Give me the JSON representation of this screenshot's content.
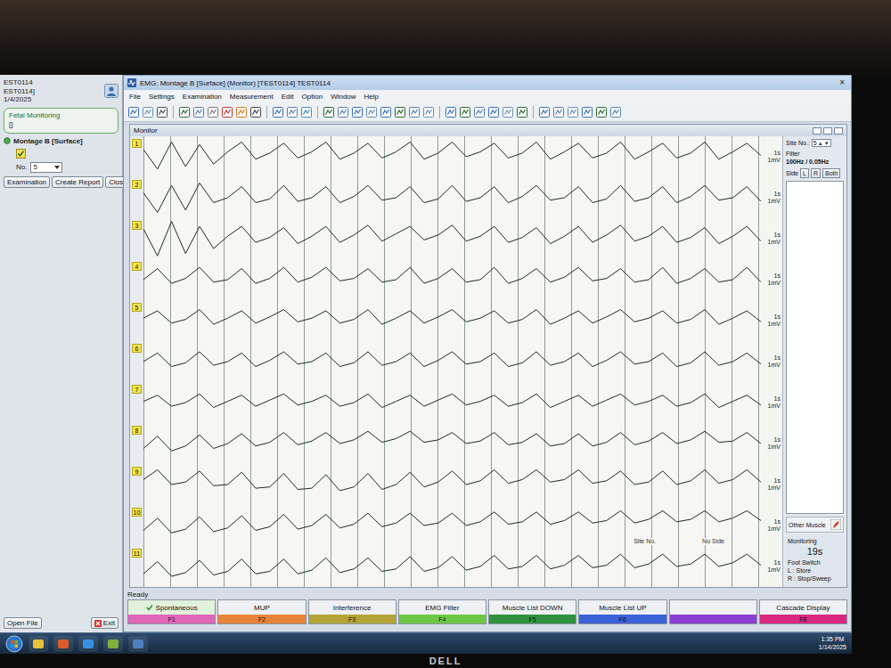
{
  "left_panel": {
    "patient_lines": [
      "EST0114",
      "EST0114]",
      "1/4/2025"
    ],
    "exam_group": {
      "title": "Fetal Monitoring",
      "value": "[]"
    },
    "montage": {
      "label": "Montage B [Surface]",
      "checked": true
    },
    "number": {
      "label": "No.",
      "value": "5"
    },
    "buttons": [
      "Examination",
      "Create Report",
      "Close"
    ],
    "bottom_buttons": [
      "Open File",
      "Exit"
    ]
  },
  "window": {
    "title": "EMG: Montage B [Surface]  (Monitor) [TEST0114]  TEST0114",
    "close": "×"
  },
  "menu": [
    "File",
    "Settings",
    "Examination",
    "Measurement",
    "Edit",
    "Option",
    "Window",
    "Help"
  ],
  "monitor": {
    "title": "Monitor",
    "channels": [
      {
        "number": "1",
        "time_scale": "1s",
        "amp_scale": "1mV",
        "labels": [],
        "values": [
          0.3,
          -0.5,
          0.6,
          -0.4,
          0.5,
          -0.3,
          0.2,
          0.6,
          -0.1,
          0.15,
          0.55,
          -0.05,
          0.2,
          0.6,
          -0.1,
          0.15,
          0.55,
          -0.05,
          0.2,
          0.6,
          -0.1,
          0.15,
          0.6,
          0.0,
          0.2,
          0.55,
          -0.05,
          0.15,
          0.6,
          -0.1,
          0.2,
          0.55,
          -0.05,
          0.15,
          0.6,
          -0.1,
          0.2,
          0.55,
          -0.05,
          0.15,
          0.6,
          -0.1,
          0.2,
          0.55,
          0.05
        ]
      },
      {
        "number": "2",
        "time_scale": "1s",
        "amp_scale": "1mV",
        "labels": [],
        "values": [
          0.2,
          -0.6,
          0.5,
          -0.5,
          0.6,
          -0.2,
          0.0,
          0.45,
          -0.2,
          -0.05,
          0.5,
          -0.15,
          0.0,
          0.45,
          -0.2,
          0.05,
          0.5,
          -0.1,
          0.0,
          0.45,
          -0.2,
          -0.05,
          0.5,
          -0.15,
          0.0,
          0.45,
          -0.2,
          0.05,
          0.5,
          -0.1,
          0.0,
          0.45,
          -0.2,
          -0.05,
          0.5,
          -0.15,
          0.0,
          0.45,
          -0.2,
          0.05,
          0.5,
          -0.1,
          0.0,
          0.45,
          -0.15
        ]
      },
      {
        "number": "3",
        "time_scale": "1s",
        "amp_scale": "1mV",
        "labels": [],
        "values": [
          0.4,
          -0.7,
          0.7,
          -0.6,
          0.5,
          -0.4,
          0.1,
          0.5,
          -0.15,
          0.05,
          0.45,
          -0.2,
          0.1,
          0.5,
          -0.15,
          0.15,
          0.55,
          -0.1,
          0.2,
          0.5,
          -0.05,
          0.15,
          0.55,
          -0.1,
          0.1,
          0.5,
          -0.15,
          0.05,
          0.45,
          -0.2,
          0.1,
          0.5,
          -0.15,
          0.15,
          0.55,
          -0.1,
          0.1,
          0.5,
          -0.15,
          0.05,
          0.45,
          -0.2,
          0.1,
          0.5,
          -0.1
        ]
      },
      {
        "number": "4",
        "time_scale": "1s",
        "amp_scale": "1mV",
        "labels": [],
        "values": [
          0.0,
          0.45,
          -0.15,
          0.05,
          0.5,
          -0.1,
          0.0,
          0.45,
          -0.15,
          0.05,
          0.5,
          -0.1,
          0.1,
          0.5,
          -0.05,
          0.05,
          0.45,
          -0.1,
          0.0,
          0.5,
          -0.15,
          0.05,
          0.45,
          -0.1,
          0.0,
          0.5,
          -0.15,
          0.05,
          0.45,
          -0.1,
          0.1,
          0.5,
          -0.05,
          0.05,
          0.45,
          -0.1,
          0.0,
          0.5,
          -0.15,
          0.05,
          0.45,
          -0.1,
          0.0,
          0.5,
          -0.1
        ]
      },
      {
        "number": "5",
        "time_scale": "1s",
        "amp_scale": "1mV",
        "labels": [],
        "values": [
          0.1,
          0.4,
          -0.1,
          0.05,
          0.45,
          -0.15,
          0.1,
          0.4,
          -0.1,
          0.15,
          0.45,
          -0.05,
          0.1,
          0.4,
          -0.1,
          0.05,
          0.45,
          -0.15,
          0.1,
          0.4,
          -0.1,
          0.15,
          0.45,
          -0.05,
          0.1,
          0.4,
          -0.1,
          0.05,
          0.45,
          -0.15,
          0.1,
          0.4,
          -0.1,
          0.15,
          0.45,
          -0.05,
          0.1,
          0.4,
          -0.1,
          0.05,
          0.45,
          -0.15,
          0.1,
          0.4,
          -0.05
        ]
      },
      {
        "number": "6",
        "time_scale": "1s",
        "amp_scale": "1mV",
        "labels": [],
        "values": [
          0.0,
          0.35,
          -0.2,
          -0.05,
          0.4,
          -0.15,
          0.0,
          0.35,
          -0.2,
          0.05,
          0.4,
          -0.1,
          0.0,
          0.35,
          -0.2,
          -0.05,
          0.4,
          -0.15,
          0.0,
          0.35,
          -0.2,
          0.05,
          0.4,
          -0.1,
          0.0,
          0.35,
          -0.2,
          -0.05,
          0.4,
          -0.15,
          0.0,
          0.35,
          -0.2,
          0.05,
          0.4,
          -0.1,
          0.0,
          0.35,
          -0.2,
          -0.05,
          0.4,
          -0.15,
          0.0,
          0.35,
          -0.1
        ]
      },
      {
        "number": "7",
        "time_scale": "1s",
        "amp_scale": "1mV",
        "labels": [],
        "values": [
          0.05,
          0.3,
          -0.15,
          0.0,
          0.35,
          -0.2,
          0.05,
          0.3,
          -0.15,
          0.1,
          0.35,
          -0.1,
          0.05,
          0.3,
          -0.15,
          0.0,
          0.35,
          -0.2,
          0.05,
          0.3,
          -0.15,
          0.1,
          0.35,
          -0.1,
          0.05,
          0.3,
          -0.15,
          0.0,
          0.35,
          -0.2,
          0.05,
          0.3,
          -0.15,
          0.1,
          0.35,
          -0.1,
          0.05,
          0.3,
          -0.15,
          0.0,
          0.35,
          -0.2,
          0.05,
          0.3,
          -0.1
        ]
      },
      {
        "number": "8",
        "time_scale": "1s",
        "amp_scale": "1mV",
        "labels": [],
        "values": [
          -0.2,
          0.3,
          -0.3,
          -0.1,
          0.35,
          -0.2,
          0.0,
          0.4,
          -0.1,
          0.05,
          0.45,
          -0.05,
          0.1,
          0.45,
          0.0,
          0.15,
          0.5,
          0.05,
          0.2,
          0.5,
          0.05,
          0.15,
          0.45,
          0.0,
          0.1,
          0.45,
          -0.05,
          0.05,
          0.4,
          -0.1,
          0.0,
          0.4,
          -0.1,
          0.05,
          0.45,
          -0.05,
          0.1,
          0.45,
          0.0,
          0.15,
          0.5,
          0.05,
          0.1,
          0.45,
          0.0
        ]
      },
      {
        "number": "9",
        "time_scale": "1s",
        "amp_scale": "1mV",
        "labels": [],
        "values": [
          0.2,
          0.6,
          0.0,
          0.1,
          0.55,
          -0.05,
          0.0,
          0.5,
          -0.15,
          -0.1,
          0.45,
          -0.2,
          -0.15,
          0.4,
          -0.25,
          -0.1,
          0.45,
          -0.2,
          0.0,
          0.5,
          -0.1,
          0.1,
          0.55,
          0.0,
          0.15,
          0.6,
          0.05,
          0.2,
          0.6,
          0.1,
          0.2,
          0.6,
          0.05,
          0.15,
          0.55,
          0.0,
          0.1,
          0.55,
          0.0,
          0.15,
          0.6,
          0.05,
          0.2,
          0.6,
          0.1
        ]
      },
      {
        "number": "10",
        "time_scale": "1s",
        "amp_scale": "1mV",
        "labels": [
          "Site No.",
          "No Side"
        ],
        "values": [
          -0.2,
          0.3,
          -0.3,
          -0.15,
          0.35,
          -0.25,
          -0.1,
          0.4,
          -0.2,
          -0.05,
          0.45,
          -0.15,
          0.0,
          0.45,
          -0.1,
          0.05,
          0.5,
          -0.05,
          0.1,
          0.5,
          0.0,
          0.1,
          0.5,
          0.0,
          0.15,
          0.55,
          0.05,
          0.15,
          0.55,
          0.05,
          0.2,
          0.55,
          0.1,
          0.2,
          0.6,
          0.1,
          0.25,
          0.6,
          0.15,
          0.25,
          0.6,
          0.15,
          0.3,
          0.6,
          0.2
        ]
      },
      {
        "number": "11",
        "time_scale": "1s",
        "amp_scale": "1mV",
        "labels": [],
        "values": [
          -0.3,
          0.2,
          -0.4,
          -0.25,
          0.25,
          -0.35,
          -0.2,
          0.3,
          -0.3,
          -0.2,
          0.3,
          -0.3,
          -0.15,
          0.35,
          -0.25,
          -0.1,
          0.35,
          -0.2,
          -0.1,
          0.4,
          -0.2,
          -0.05,
          0.4,
          -0.15,
          0.0,
          0.45,
          -0.1,
          0.0,
          0.45,
          -0.1,
          0.05,
          0.45,
          -0.05,
          0.05,
          0.5,
          -0.05,
          0.1,
          0.5,
          0.0,
          0.1,
          0.5,
          0.0,
          0.15,
          0.5,
          0.05
        ]
      }
    ]
  },
  "side_panel": {
    "site_label": "Site No.:",
    "site_value": "5",
    "up": "▲",
    "down": "▼",
    "filter_label": "Filter",
    "filter_value": "100Hz / 0.05Hz",
    "side_label": "Side",
    "side_buttons": [
      {
        "label": "L",
        "selected": false
      },
      {
        "label": "R",
        "selected": false
      },
      {
        "label": "Both",
        "selected": false
      }
    ],
    "other_muscle": "Other Muscle",
    "monitoring_label": "Monitoring",
    "monitoring_time": "19s",
    "foot_switch_label": "Foot Switch",
    "foot_switch_lines": [
      "L : Store",
      "R : Stop/Sweep"
    ]
  },
  "status": "Ready",
  "function_keys": [
    {
      "label": "Spontaneous",
      "key": "F1",
      "color": "#e066b8",
      "selected": true
    },
    {
      "label": "MUP",
      "key": "F2",
      "color": "#e8843a",
      "selected": false
    },
    {
      "label": "Interference",
      "key": "F3",
      "color": "#b3a437",
      "selected": false
    },
    {
      "label": "EMG Filter",
      "key": "F4",
      "color": "#6cc844",
      "selected": false
    },
    {
      "label": "Muscle List DOWN",
      "key": "F5",
      "color": "#2f9140",
      "selected": false
    },
    {
      "label": "Muscle List UP",
      "key": "F6",
      "color": "#3b62d6",
      "selected": false
    },
    {
      "label": "",
      "key": "",
      "color": "#8a3fd2",
      "selected": false
    },
    {
      "label": "Cascade Display",
      "key": "F8",
      "color": "#d8287f",
      "selected": false
    }
  ],
  "taskbar": {
    "time": "1:35 PM",
    "date": "1/14/2025"
  },
  "monitor_brand": "DELL"
}
